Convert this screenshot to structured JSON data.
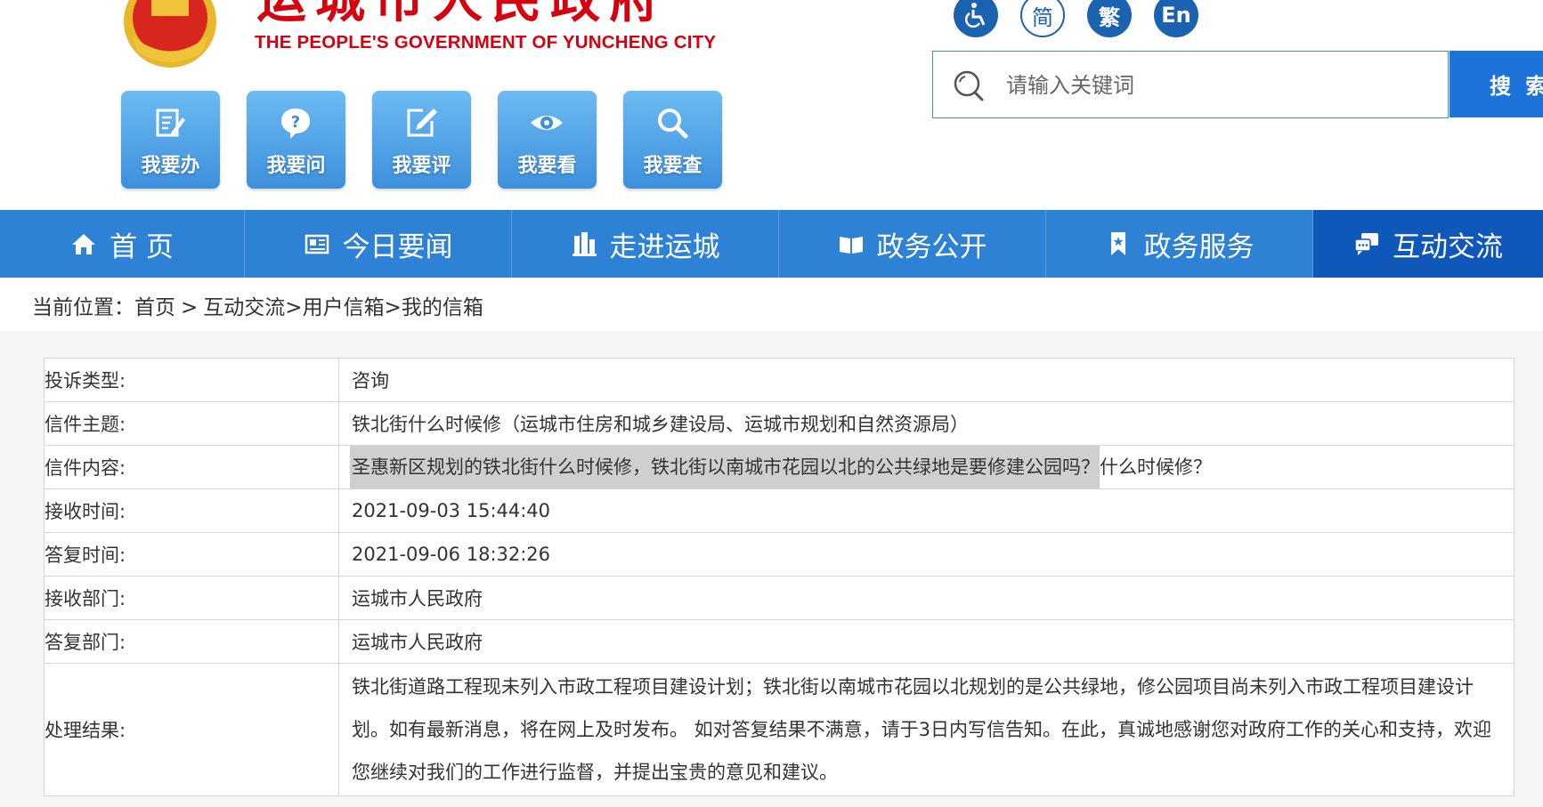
{
  "header": {
    "title_cn": "运城市人民政府",
    "title_en": "THE PEOPLE'S GOVERNMENT OF YUNCHENG  CITY",
    "emblem_icon": "national-emblem-icon",
    "tiles": [
      {
        "label": "我要办",
        "icon": "edit-document-icon"
      },
      {
        "label": "我要问",
        "icon": "question-bubble-icon"
      },
      {
        "label": "我要评",
        "icon": "pen-square-icon"
      },
      {
        "label": "我要看",
        "icon": "eye-icon"
      },
      {
        "label": "我要查",
        "icon": "search-icon"
      }
    ],
    "toggles": [
      {
        "label": "",
        "icon": "accessibility-icon"
      },
      {
        "label": "简"
      },
      {
        "label": "繁"
      },
      {
        "label": "En"
      }
    ]
  },
  "search": {
    "placeholder": "请输入关键词",
    "button_label": "搜 索"
  },
  "nav": {
    "items": [
      {
        "label": "首 页",
        "icon": "home-icon"
      },
      {
        "label": "今日要闻",
        "icon": "news-icon"
      },
      {
        "label": "走进运城",
        "icon": "city-building-icon"
      },
      {
        "label": "政务公开",
        "icon": "open-book-icon"
      },
      {
        "label": "政务服务",
        "icon": "bookmark-icon"
      },
      {
        "label": "互动交流",
        "icon": "chat-bubbles-icon"
      }
    ]
  },
  "breadcrumb": {
    "prefix": "当前位置：",
    "home": "首页",
    "sep1": ">",
    "c1": "互动交流",
    "sep2": ">",
    "c2": "用户信箱",
    "sep3": ">",
    "c3": "我的信箱"
  },
  "letter": {
    "rows": [
      {
        "label": "投诉类型:",
        "value": "咨询"
      },
      {
        "label": "信件主题:",
        "value": "铁北街什么时候修（运城市住房和城乡建设局、运城市规划和自然资源局）"
      },
      {
        "label": "信件内容:",
        "value_highlight": "圣惠新区规划的铁北街什么时候修，铁北街以南城市花园以北的公共绿地是要修建公园吗？",
        "value_rest": "什么时候修？"
      },
      {
        "label": "接收时间:",
        "value": "2021-09-03 15:44:40"
      },
      {
        "label": "答复时间:",
        "value": "2021-09-06 18:32:26"
      },
      {
        "label": "接收部门:",
        "value": "运城市人民政府"
      },
      {
        "label": "答复部门:",
        "value": "运城市人民政府"
      },
      {
        "label": "处理结果:",
        "value": "铁北街道路工程现未列入市政工程项目建设计划；铁北街以南城市花园以北规划的是公共绿地，修公园项目尚未列入市政工程项目建设计划。如有最新消息，将在网上及时发布。 如对答复结果不满意，请于3日内写信告知。在此，真诚地感谢您对政府工作的关心和支持，欢迎您继续对我们的工作进行监督，并提出宝贵的意见和建议。"
      }
    ]
  },
  "colors": {
    "brand_red": "#d7000f",
    "nav_blue": "#2d82d6",
    "nav_active": "#0f57b8",
    "tile_blue": "#4a9ae3"
  }
}
